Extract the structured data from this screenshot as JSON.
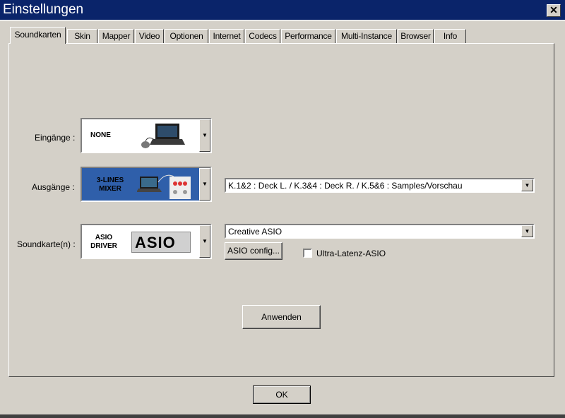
{
  "window": {
    "title": "Einstellungen",
    "close_glyph": "✕"
  },
  "tabs": [
    "Soundkarten",
    "Skin",
    "Mapper",
    "Video",
    "Optionen",
    "Internet",
    "Codecs",
    "Performance",
    "Multi-Instance",
    "Browser",
    "Info"
  ],
  "inputs": {
    "label": "Eingänge :",
    "image_text": "NONE"
  },
  "outputs": {
    "label": "Ausgänge :",
    "image_text_line1": "3-LINES",
    "image_text_line2": "MIXER",
    "routing_value": "K.1&2 : Deck L. / K.3&4 : Deck R. / K.5&6 : Samples/Vorschau"
  },
  "soundcard": {
    "label": "Soundkarte(n) :",
    "image_text_line1": "ASIO",
    "image_text_line2": "DRIVER",
    "logo_text": "ASIO",
    "driver_value": "Creative ASIO",
    "config_button": "ASIO config...",
    "ultra_latency_label": "Ultra-Latenz-ASIO",
    "ultra_latency_checked": false
  },
  "apply_button": "Anwenden",
  "ok_button": "OK",
  "icons": {
    "dropdown": "▼"
  }
}
